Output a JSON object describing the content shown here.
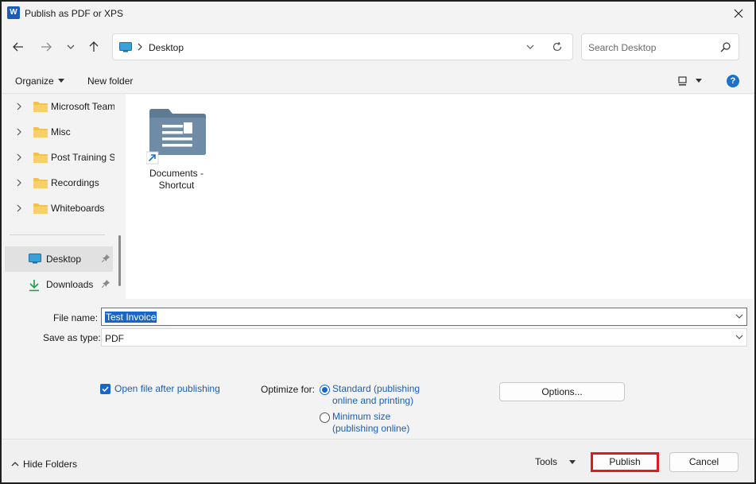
{
  "window": {
    "title": "Publish as PDF or XPS",
    "app_icon_letter": "W"
  },
  "navigation": {
    "breadcrumb": "Desktop",
    "search_placeholder": "Search Desktop"
  },
  "toolbar": {
    "organize_label": "Organize",
    "new_folder_label": "New folder",
    "help_label": "?"
  },
  "nav_pane": {
    "tree_items": [
      {
        "label": "Microsoft Teams"
      },
      {
        "label": "Misc"
      },
      {
        "label": "Post Training Surveys"
      },
      {
        "label": "Recordings"
      },
      {
        "label": "Whiteboards"
      }
    ],
    "quick_access": [
      {
        "label": "Desktop",
        "selected": true
      },
      {
        "label": "Downloads",
        "selected": false
      }
    ]
  },
  "content": {
    "items": [
      {
        "label_line1": "Documents -",
        "label_line2": "Shortcut",
        "type": "folder-shortcut"
      }
    ]
  },
  "save_form": {
    "file_name_label": "File name:",
    "file_name_value": "Test Invoice",
    "save_type_label": "Save as type:",
    "save_type_value": "PDF"
  },
  "options": {
    "open_after_label": "Open file after publishing",
    "open_after_checked": true,
    "optimize_label": "Optimize for:",
    "standard_line1": "Standard (publishing",
    "standard_line2": "online and printing)",
    "minimum_line1": "Minimum size",
    "minimum_line2": "(publishing online)",
    "selected_optimize": "standard",
    "options_button": "Options..."
  },
  "footer": {
    "hide_folders_label": "Hide Folders",
    "tools_label": "Tools",
    "publish_label": "Publish",
    "cancel_label": "Cancel"
  },
  "colors": {
    "accent": "#1a66c8",
    "highlight_border": "#d81e1e",
    "link_text": "#1a5fb4",
    "folder_yellow": "#f2c14e",
    "folder_slate": "#5f7a93"
  }
}
